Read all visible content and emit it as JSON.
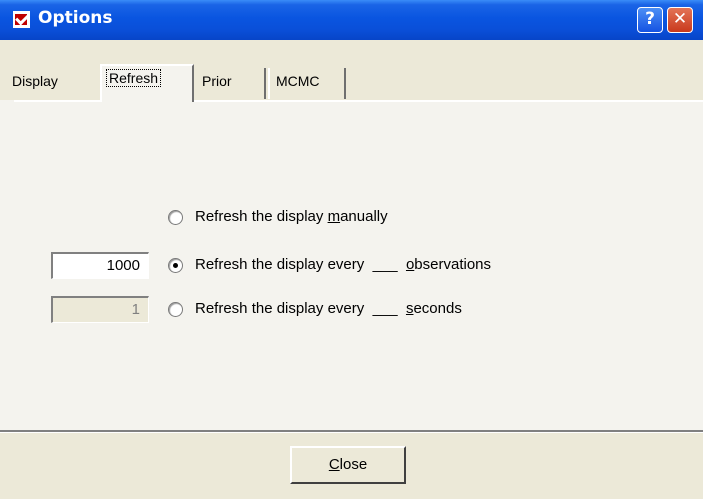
{
  "window": {
    "title": "Options"
  },
  "titlebar": {
    "help_glyph": "?",
    "close_glyph": "✕"
  },
  "tabs": [
    {
      "label": "Display"
    },
    {
      "label": "Refresh",
      "selected": true
    },
    {
      "label": "Prior"
    },
    {
      "label": "MCMC"
    }
  ],
  "refresh": {
    "options": [
      {
        "prefix": "Refresh the display ",
        "mnemonic": "m",
        "suffix": "anually",
        "checked": false
      },
      {
        "prefix": "Refresh the display every  ___  ",
        "mnemonic": "o",
        "suffix": "bservations",
        "checked": true,
        "field_value": "1000",
        "field_enabled": true
      },
      {
        "prefix": "Refresh the display every  ___  ",
        "mnemonic": "s",
        "suffix": "econds",
        "checked": false,
        "field_value": "1",
        "field_enabled": false
      }
    ]
  },
  "footer": {
    "close_mnemonic": "C",
    "close_rest": "lose"
  },
  "colors": {
    "titlebar": "#0A55E0",
    "dialog_bg": "#ECE9D8",
    "page_bg": "#F4F3EE"
  }
}
